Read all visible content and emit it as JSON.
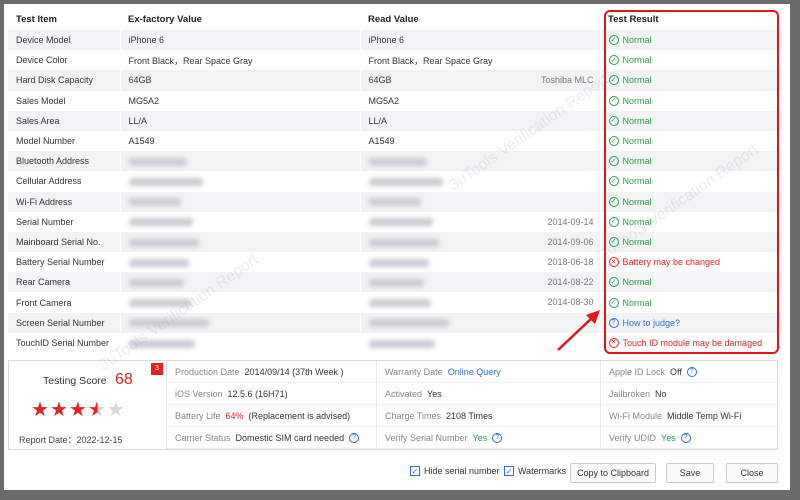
{
  "table": {
    "headers": [
      "Test Item",
      "Ex-factory Value",
      "Read Value",
      "Test Result"
    ],
    "rows": [
      {
        "item": "Device Model",
        "factory": "iPhone 6",
        "read": "iPhone 6",
        "date": "",
        "result": "Normal",
        "status": "ok"
      },
      {
        "item": "Device Color",
        "factory": "Front Black，Rear Space Gray",
        "read": "Front Black，Rear Space Gray",
        "date": "",
        "result": "Normal",
        "status": "ok"
      },
      {
        "item": "Hard Disk Capacity",
        "factory": "64GB",
        "read": "64GB",
        "date": "Toshiba MLC",
        "result": "Normal",
        "status": "ok"
      },
      {
        "item": "Sales Model",
        "factory": "MG5A2",
        "read": "MG5A2",
        "date": "",
        "result": "Normal",
        "status": "ok"
      },
      {
        "item": "Sales Area",
        "factory": "LL/A",
        "read": "LL/A",
        "date": "",
        "result": "Normal",
        "status": "ok"
      },
      {
        "item": "Model Number",
        "factory": "A1549",
        "read": "A1549",
        "date": "",
        "result": "Normal",
        "status": "ok"
      },
      {
        "item": "Bluetooth Address",
        "factory": "",
        "read": "",
        "date": "",
        "result": "Normal",
        "status": "ok"
      },
      {
        "item": "Cellular Address",
        "factory": "",
        "read": "",
        "date": "",
        "result": "Normal",
        "status": "ok"
      },
      {
        "item": "Wi-Fi Address",
        "factory": "",
        "read": "",
        "date": "",
        "result": "Normal",
        "status": "ok"
      },
      {
        "item": "Serial Number",
        "factory": "",
        "read": "",
        "date": "2014-09-14",
        "result": "Normal",
        "status": "ok"
      },
      {
        "item": "Mainboard Serial No.",
        "factory": "",
        "read": "",
        "date": "2014-09-06",
        "result": "Normal",
        "status": "ok"
      },
      {
        "item": "Battery Serial Number",
        "factory": "",
        "read": "",
        "date": "2018-06-18",
        "result": "Battery may be changed",
        "status": "bad"
      },
      {
        "item": "Rear Camera",
        "factory": "",
        "read": "",
        "date": "2014-08-22",
        "result": "Normal",
        "status": "ok"
      },
      {
        "item": "Front Camera",
        "factory": "",
        "read": "",
        "date": "2014-08-30",
        "result": "Normal",
        "status": "ok"
      },
      {
        "item": "Screen Serial Number",
        "factory": "",
        "read": "",
        "date": "",
        "result": "How to judge?",
        "status": "link"
      },
      {
        "item": "TouchID Serial Number",
        "factory": "",
        "read": "",
        "date": "",
        "result": "Touch ID module may be damaged",
        "status": "bad"
      }
    ]
  },
  "score": {
    "label": "Testing Score",
    "value": "68",
    "badge": "3",
    "stars": 3.5,
    "stars_max": 5,
    "report_date": "Report Date：2022-12-15"
  },
  "info": [
    {
      "k": "Production Date",
      "v": "2014/09/14 (37th Week )",
      "style": ""
    },
    {
      "k": "Warranty Date",
      "v": "Online Query",
      "style": "blue"
    },
    {
      "k": "Apple ID Lock",
      "v": "Off",
      "style": "",
      "help": true
    },
    {
      "k": "iOS Version",
      "v": "12.5.6 (16H71)",
      "style": ""
    },
    {
      "k": "Activated",
      "v": "Yes",
      "style": ""
    },
    {
      "k": "Jailbroken",
      "v": "No",
      "style": ""
    },
    {
      "k": "Battery Life",
      "v": "64%",
      "v2": "(Replacement is advised)",
      "style": "red"
    },
    {
      "k": "Charge Times",
      "v": "2108 Times",
      "style": ""
    },
    {
      "k": "Wi-Fi Module",
      "v": "Middle Temp Wi-Fi",
      "style": ""
    },
    {
      "k": "Carrier Status",
      "v": "Domestic SIM card needed",
      "style": "",
      "help": true
    },
    {
      "k": "Verify Serial Number",
      "v": "Yes",
      "style": "green",
      "help": true
    },
    {
      "k": "Verify UDID",
      "v": "Yes",
      "style": "green",
      "help": true
    }
  ],
  "footer": {
    "hide_serial_label": "Hide serial number",
    "watermarks_label": "Watermarks",
    "copy_label": "Copy to Clipboard",
    "save_label": "Save",
    "close_label": "Close"
  },
  "colors": {
    "ok": "#2a9d4a",
    "bad": "#e02424",
    "link": "#2f6fd6",
    "highlight": "#e3141c"
  },
  "watermark_text": "3uTools Verification Report"
}
